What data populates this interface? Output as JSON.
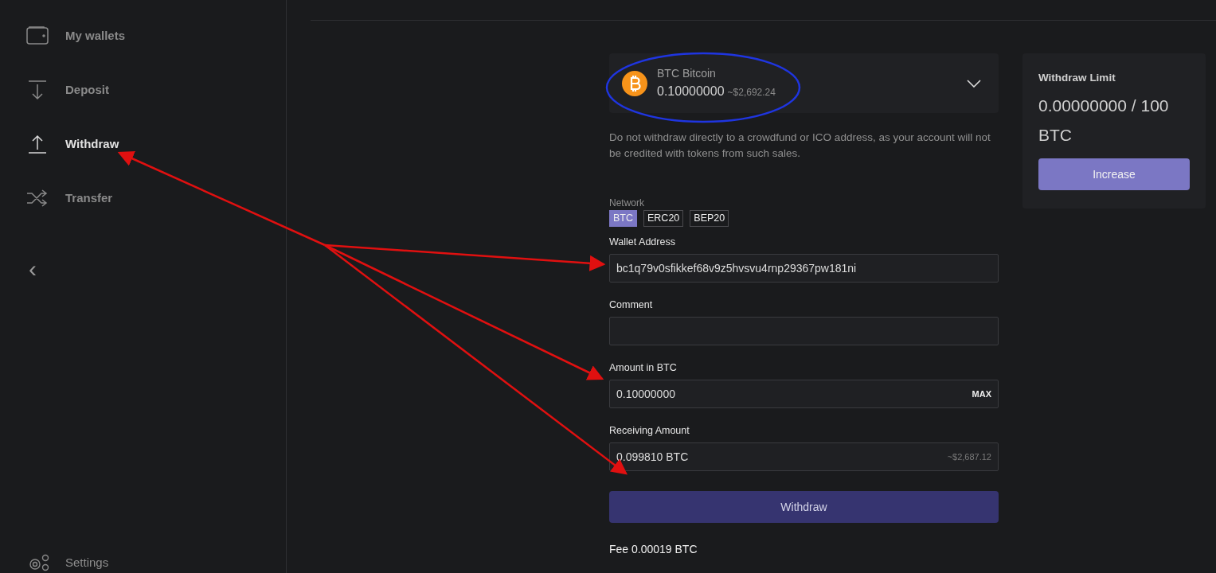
{
  "sidebar": {
    "items": [
      {
        "label": "My wallets",
        "selected": false
      },
      {
        "label": "Deposit",
        "selected": false
      },
      {
        "label": "Withdraw",
        "selected": true
      },
      {
        "label": "Transfer",
        "selected": false
      }
    ],
    "collapse": "‹",
    "settings": {
      "label": "Settings"
    }
  },
  "asset": {
    "name": "BTC Bitcoin",
    "balance": "0.10000000",
    "usd": "~$2,692.24"
  },
  "notice": "Do not withdraw directly to a crowdfund or ICO address, as your account will not be credited with tokens from such sales.",
  "network": {
    "label": "Network",
    "options": [
      {
        "label": "BTC",
        "selected": true
      },
      {
        "label": "ERC20",
        "selected": false
      },
      {
        "label": "BEP20",
        "selected": false
      }
    ]
  },
  "fields": [
    {
      "label": "Wallet Address",
      "value": "bc1q79v0sfikkef68v9z5hvsvu4rnp29367pw181ni"
    },
    {
      "label": "Comment"
    },
    {
      "label": "Amount in BTC",
      "value": "0.10000000",
      "action": "MAX"
    },
    {
      "label": "Receiving Amount",
      "value": "0.099810 BTC",
      "hint": "~$2,687.12"
    }
  ],
  "withdraw_button": "Withdraw",
  "fee": "Fee 0.00019 BTC",
  "limit_card": {
    "title": "Withdraw Limit",
    "value": "0.00000000 / 100 BTC",
    "button": "Increase"
  }
}
